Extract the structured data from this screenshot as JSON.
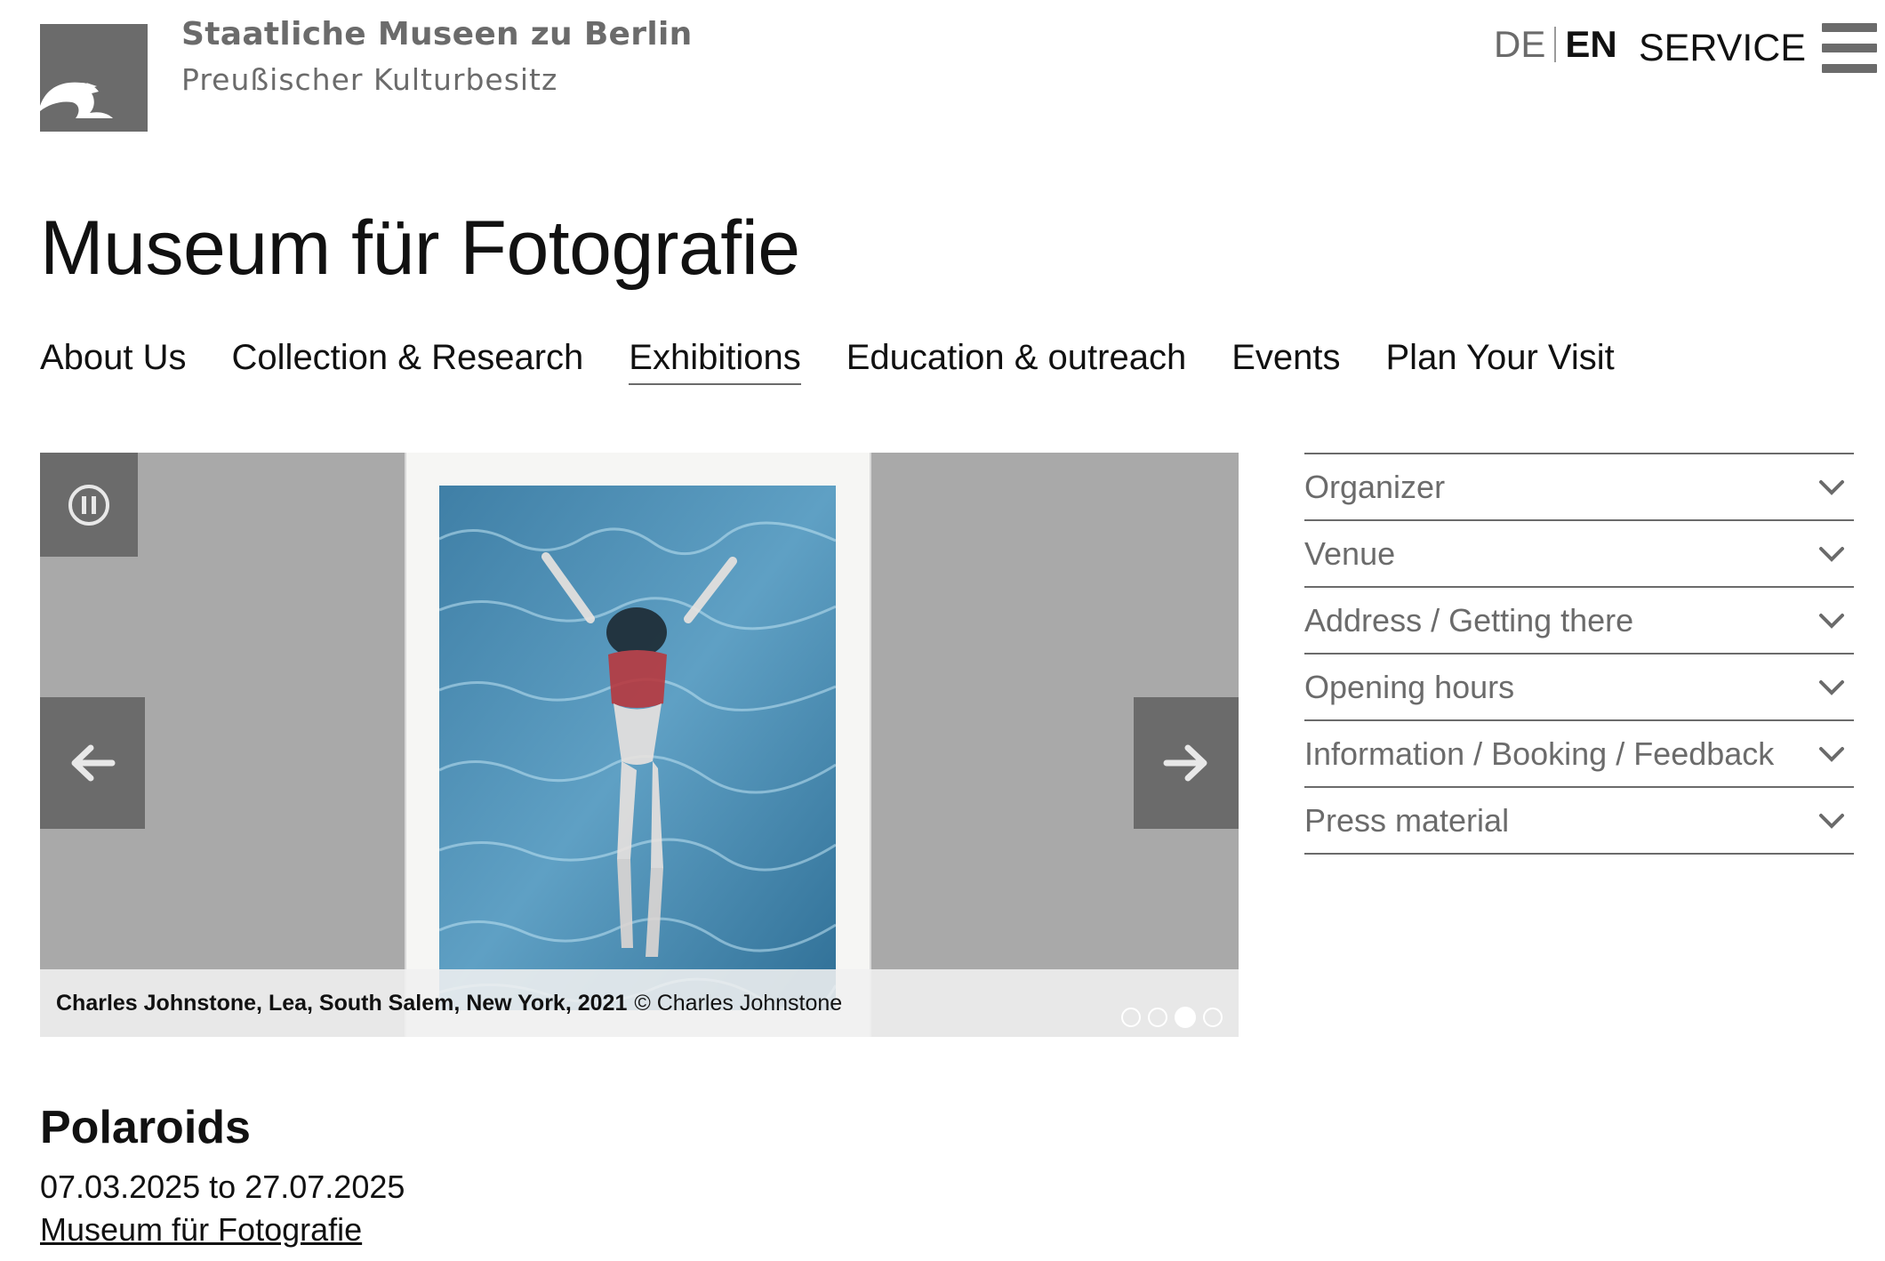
{
  "header": {
    "org_name": "Staatliche Museen zu Berlin",
    "org_subtitle": "Preußischer Kulturbesitz",
    "lang_de": "DE",
    "lang_en": "EN",
    "service_label": "SERVICE"
  },
  "page_title": "Museum für Fotografie",
  "nav": [
    {
      "label": "About Us",
      "active": false
    },
    {
      "label": "Collection & Research",
      "active": false
    },
    {
      "label": "Exhibitions",
      "active": true
    },
    {
      "label": "Education & outreach",
      "active": false
    },
    {
      "label": "Events",
      "active": false
    },
    {
      "label": "Plan Your Visit",
      "active": false
    }
  ],
  "slider": {
    "caption_bold": "Charles Johnstone, Lea, South Salem, New York, 2021",
    "caption_rest": "© Charles Johnstone",
    "slide_count": 4,
    "active_slide_index": 2
  },
  "accordion": [
    {
      "label": "Organizer"
    },
    {
      "label": "Venue"
    },
    {
      "label": "Address / Getting there"
    },
    {
      "label": "Opening hours"
    },
    {
      "label": "Information / Booking / Feedback"
    },
    {
      "label": "Press material"
    }
  ],
  "exhibition": {
    "title": "Polaroids",
    "dates": "07.03.2025 to 27.07.2025",
    "venue_link": "Museum für Fotografie"
  },
  "colors": {
    "brand_gray": "#6b6b6b",
    "slider_bg": "#a9a9a9",
    "text": "#111111"
  }
}
